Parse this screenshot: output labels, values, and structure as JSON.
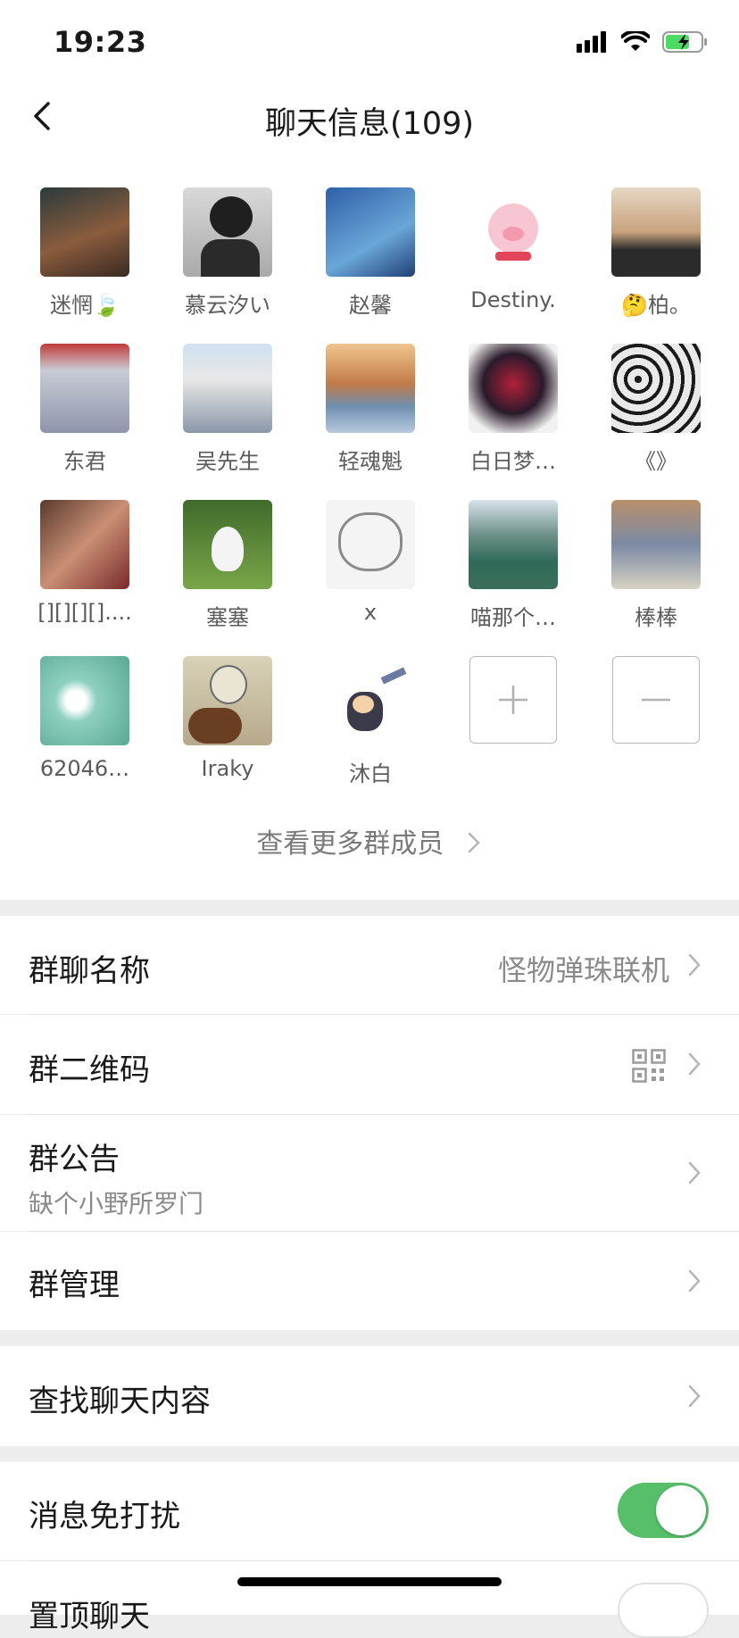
{
  "status_bar": {
    "time": "19:23"
  },
  "nav": {
    "title": "聊天信息(109)"
  },
  "members": [
    {
      "name": "迷惘🍃",
      "color": "#6b4a36"
    },
    {
      "name": "慕云汐い",
      "color": "#bfbfbf"
    },
    {
      "name": "赵馨",
      "color": "#3b6fb8"
    },
    {
      "name": "Destiny.",
      "color": "#fbe0e6"
    },
    {
      "name": "🤔柏。",
      "color": "#c8a98a"
    },
    {
      "name": "东君",
      "color": "#b9bfcc"
    },
    {
      "name": "吴先生",
      "color": "#9fb4c8"
    },
    {
      "name": "轻魂魁",
      "color": "#c99a6a"
    },
    {
      "name": "白日梦…",
      "color": "#2a2a2a"
    },
    {
      "name": "《》",
      "color": "#d8d8d8"
    },
    {
      "name": "[][][][]....",
      "color": "#8a5a45"
    },
    {
      "name": "塞塞",
      "color": "#5f8a3a"
    },
    {
      "name": "x",
      "color": "#f2f2f2"
    },
    {
      "name": "喵那个…",
      "color": "#5c8f86"
    },
    {
      "name": "棒棒",
      "color": "#7b8aa5"
    },
    {
      "name": "62046…",
      "color": "#7fc2b2"
    },
    {
      "name": "Iraky",
      "color": "#c9c0a0"
    },
    {
      "name": "沐白",
      "color": "#ffffff"
    }
  ],
  "actions": {
    "add_icon": "plus-icon",
    "remove_icon": "minus-icon"
  },
  "more_members": "查看更多群成员",
  "rows": {
    "group_name": {
      "label": "群聊名称",
      "value": "怪物弹珠联机"
    },
    "qr_code": {
      "label": "群二维码",
      "icon": "qr-code-icon"
    },
    "announcement": {
      "label": "群公告",
      "sub": "缺个小野所罗门"
    },
    "management": {
      "label": "群管理"
    },
    "search_history": {
      "label": "查找聊天内容"
    },
    "mute": {
      "label": "消息免打扰",
      "on": true
    },
    "pin": {
      "label": "置顶聊天",
      "on": false
    }
  },
  "colors": {
    "accent_green": "#57be6a",
    "bg_gray": "#ededed"
  }
}
